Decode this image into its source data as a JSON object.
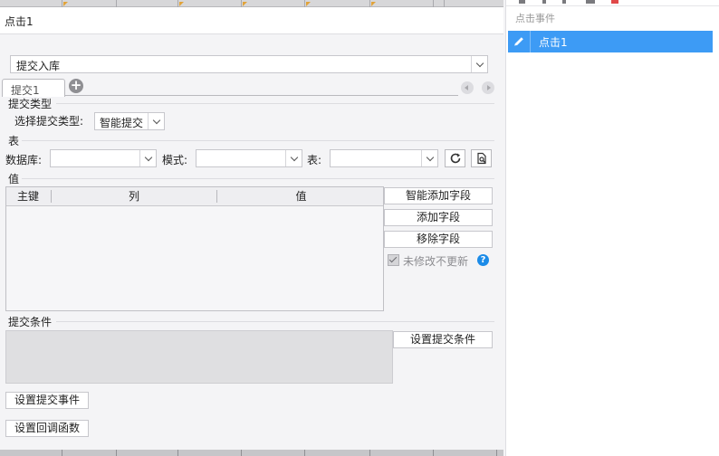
{
  "dialog": {
    "title": "点击1",
    "submit_type_combo": "提交入库",
    "tab_label": "提交1"
  },
  "submit_type": {
    "section": "提交类型",
    "label": "选择提交类型:",
    "value": "智能提交"
  },
  "table_section": {
    "section": "表",
    "database_label": "数据库:",
    "mode_label": "模式:",
    "table_label": "表:"
  },
  "values_section": {
    "section": "值",
    "columns": [
      "主键",
      "列",
      "值"
    ],
    "smart_add_button": "智能添加字段",
    "add_button": "添加字段",
    "remove_button": "移除字段",
    "no_update_checkbox": "未修改不更新"
  },
  "condition_section": {
    "section": "提交条件",
    "set_condition_button": "设置提交条件"
  },
  "bottom_buttons": {
    "set_event": "设置提交事件",
    "set_callback": "设置回调函数"
  },
  "right_panel": {
    "header": "点击事件",
    "selected_item": "点击1"
  },
  "colors": {
    "accent": "#3d9bf5",
    "help": "#1b8be8"
  }
}
